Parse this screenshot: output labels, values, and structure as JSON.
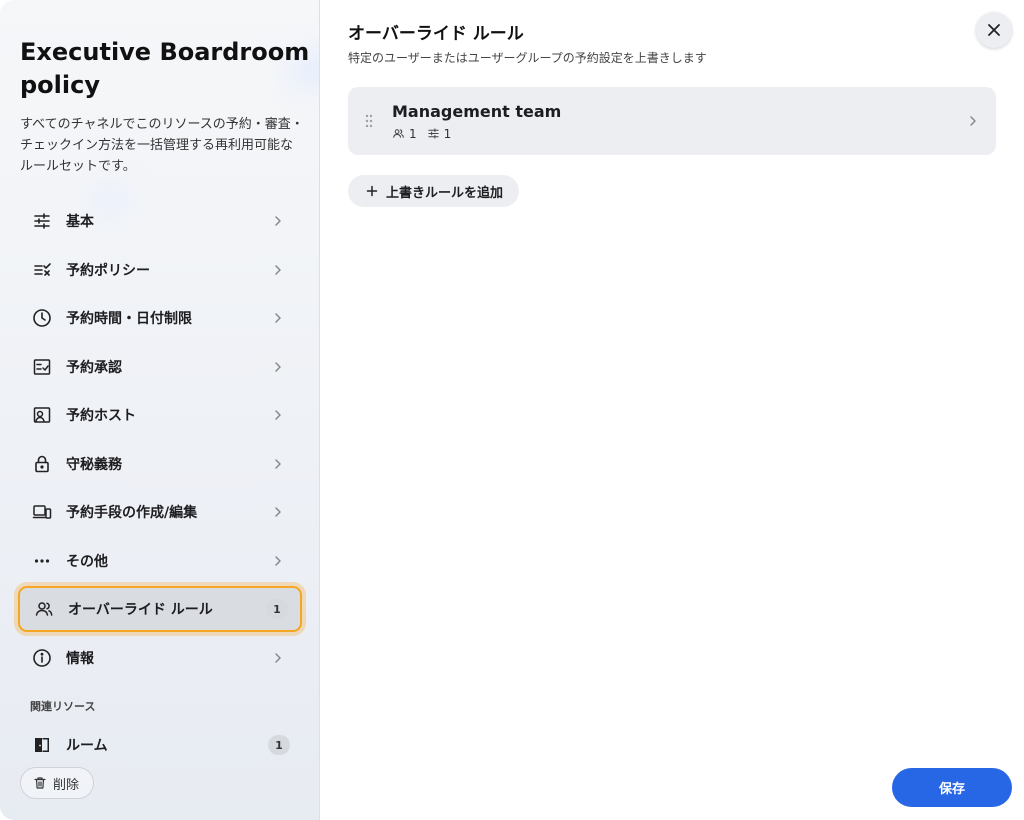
{
  "policy": {
    "title": "Executive Boardroom policy",
    "description": "すべてのチャネルでこのリソースの予約・審査・チェックイン方法を一括管理する再利用可能なルールセットです。"
  },
  "sidebar": {
    "items": [
      {
        "label": "基本",
        "icon": "sliders-icon"
      },
      {
        "label": "予約ポリシー",
        "icon": "list-check-icon"
      },
      {
        "label": "予約時間・日付制限",
        "icon": "clock-icon"
      },
      {
        "label": "予約承認",
        "icon": "approval-icon"
      },
      {
        "label": "予約ホスト",
        "icon": "host-icon"
      },
      {
        "label": "守秘義務",
        "icon": "lock-icon"
      },
      {
        "label": "予約手段の作成/編集",
        "icon": "devices-icon"
      },
      {
        "label": "その他",
        "icon": "more-icon"
      },
      {
        "label": "オーバーライド ルール",
        "icon": "users-icon",
        "count": "1",
        "active": true
      },
      {
        "label": "情報",
        "icon": "info-icon"
      }
    ],
    "related_section_label": "関連リソース",
    "related": [
      {
        "label": "ルーム",
        "icon": "door-icon",
        "count": "1"
      }
    ],
    "delete_label": "削除"
  },
  "main": {
    "title": "オーバーライド ルール",
    "subtitle": "特定のユーザーまたはユーザーグループの予約設定を上書きします",
    "rules": [
      {
        "name": "Management team",
        "users_count": "1",
        "settings_count": "1"
      }
    ],
    "add_rule_label": "上書きルールを追加",
    "save_label": "保存"
  },
  "colors": {
    "accent": "#2767e6",
    "active_outline": "#f5a623"
  }
}
